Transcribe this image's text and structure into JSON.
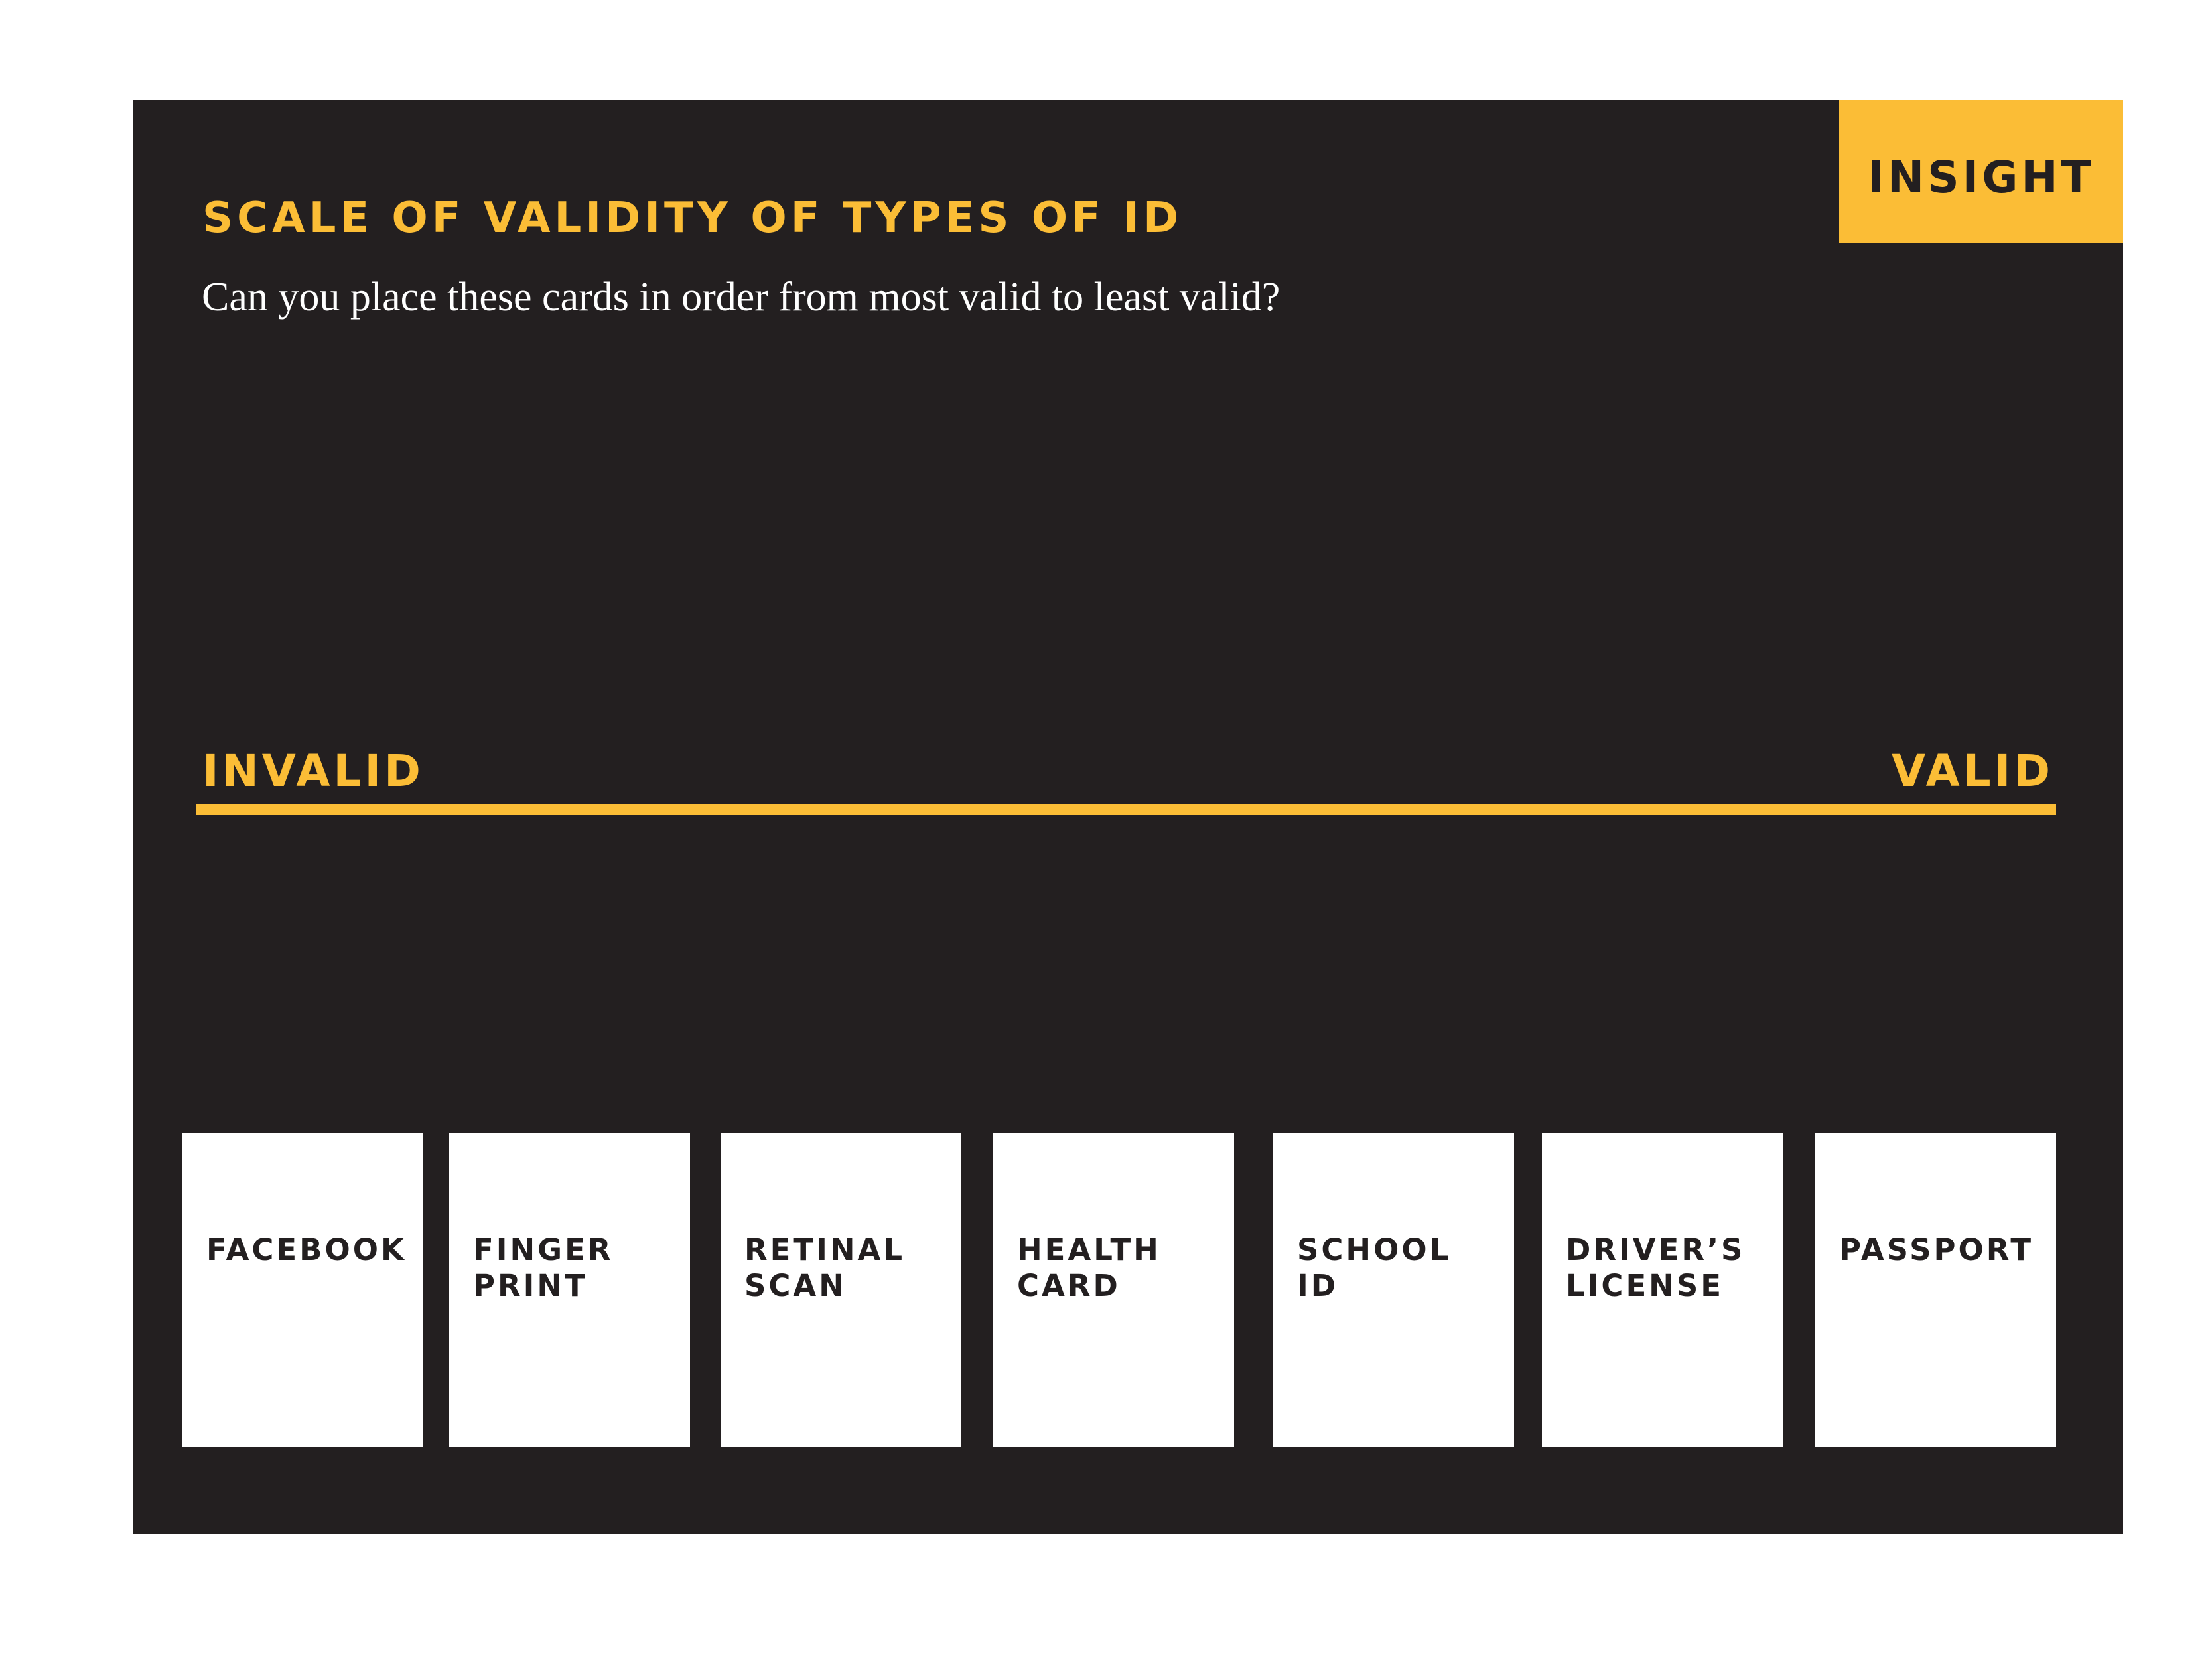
{
  "tag": {
    "label": "INSIGHT"
  },
  "header": {
    "title": "SCALE OF VALIDITY OF TYPES OF ID",
    "subtitle": "Can you place these cards in order from most valid to least valid?"
  },
  "scale": {
    "left_label": "INVALID",
    "right_label": "VALID"
  },
  "cards": [
    {
      "label": "FACEBOOK"
    },
    {
      "label": "FINGER\nPRINT"
    },
    {
      "label": "RETINAL\nSCAN"
    },
    {
      "label": "HEALTH\nCARD"
    },
    {
      "label": "SCHOOL\nID"
    },
    {
      "label": "DRIVER’S\nLICENSE"
    },
    {
      "label": "PASSPORT"
    }
  ],
  "colors": {
    "background": "#231f20",
    "accent": "#fbbd36",
    "card": "#ffffff"
  }
}
